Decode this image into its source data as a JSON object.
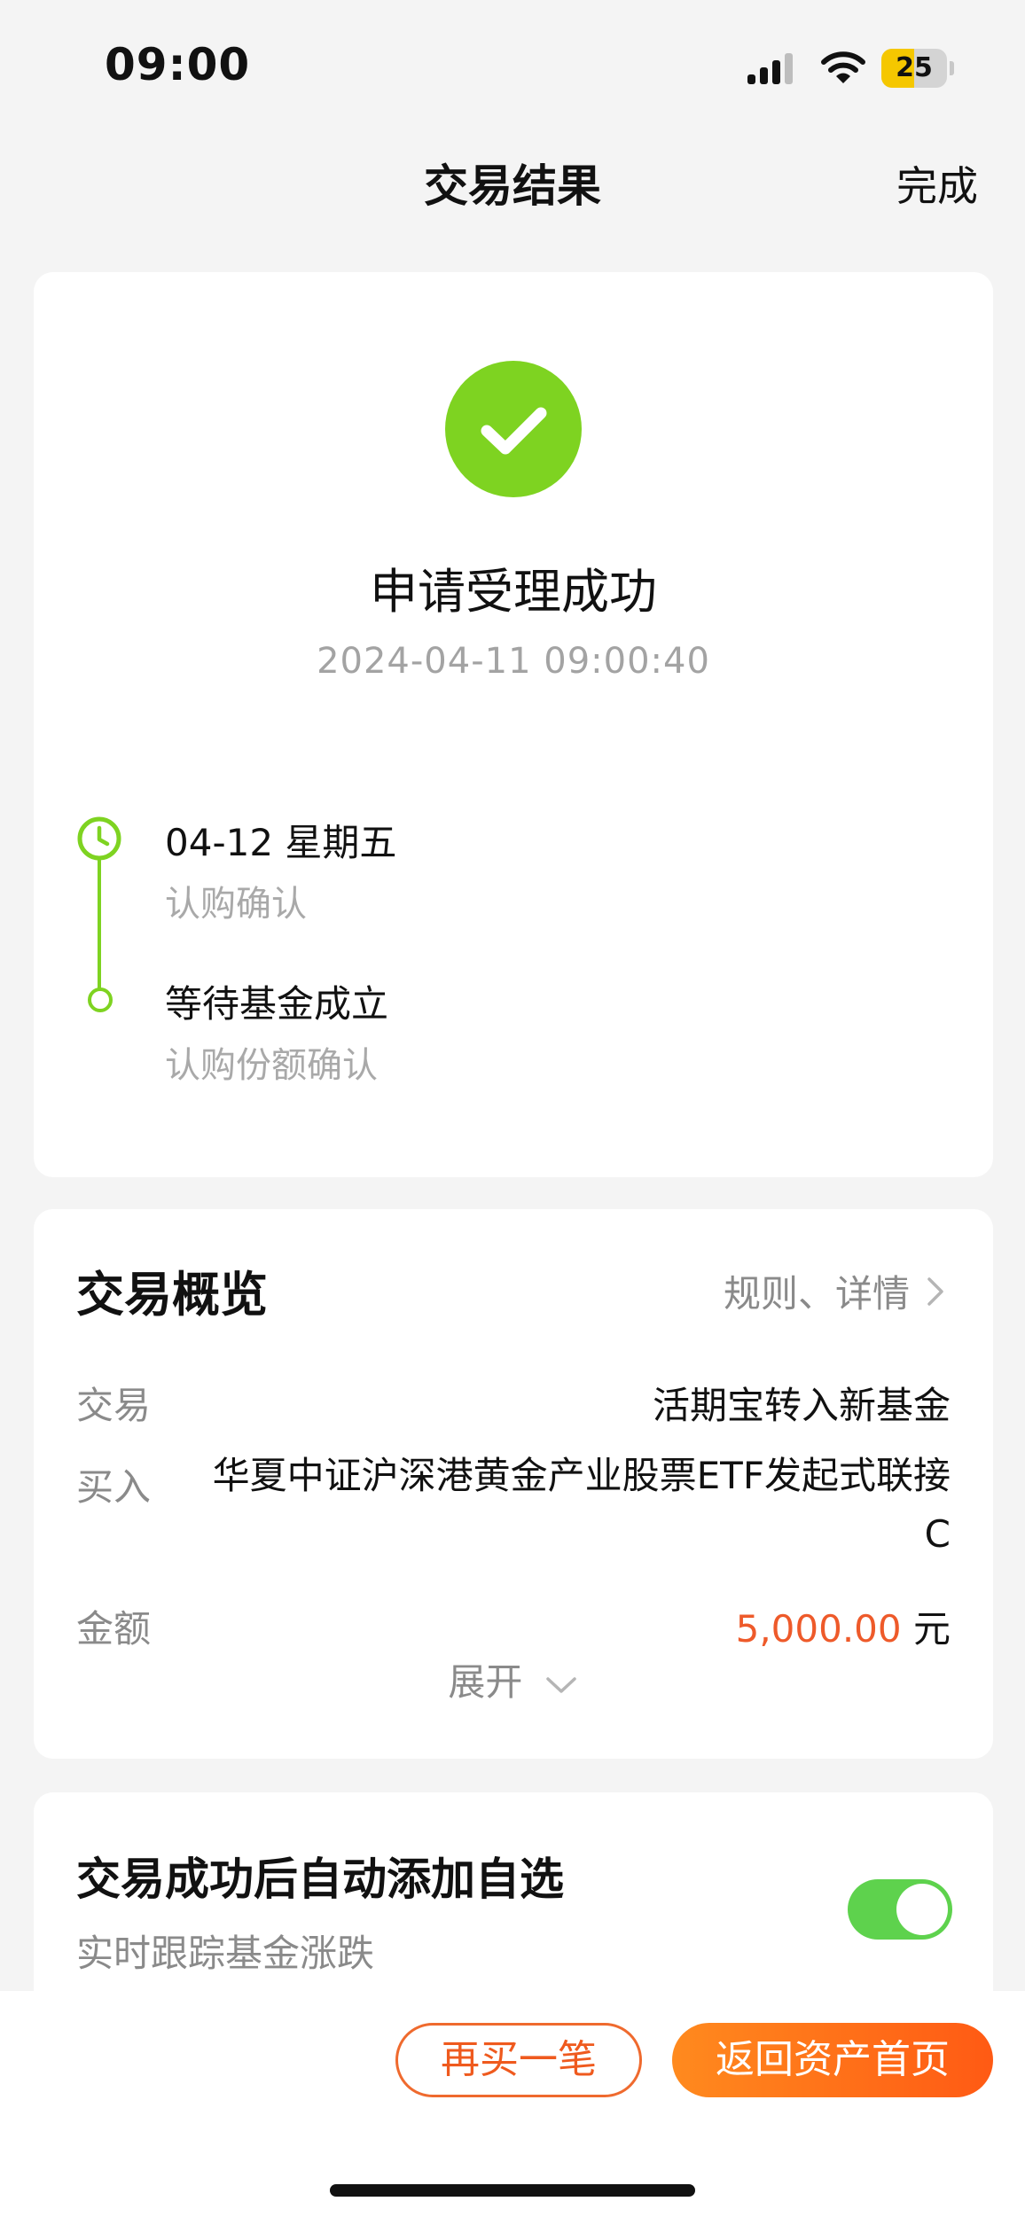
{
  "status_bar": {
    "time": "09:00",
    "battery_level": "25",
    "battery_fraction": 0.5,
    "icons": [
      "signal-icon",
      "wifi-icon",
      "battery-icon"
    ]
  },
  "nav": {
    "title": "交易结果",
    "done_label": "完成"
  },
  "result": {
    "icon": "checkmark-icon",
    "title": "申请受理成功",
    "timestamp": "2024-04-11 09:00:40",
    "timeline": [
      {
        "title": "04-12  星期五",
        "subtitle": "认购确认",
        "icon": "clock-icon"
      },
      {
        "title": "等待基金成立",
        "subtitle": "认购份额确认",
        "icon": "circle-icon"
      }
    ]
  },
  "overview": {
    "title": "交易概览",
    "link_label": "规则、详情",
    "rows": {
      "trade_label": "交易",
      "trade_value": "活期宝转入新基金",
      "buy_label": "买入",
      "buy_value": "华夏中证沪深港黄金产业股票ETF发起式联接C",
      "amount_label": "金额",
      "amount_value": "5,000.00",
      "amount_unit": "元"
    },
    "expand_label": "展开"
  },
  "auto_add": {
    "title": "交易成功后自动添加自选",
    "subtitle": "实时跟踪基金涨跌",
    "enabled": true
  },
  "actions": {
    "buy_again_label": "再买一笔",
    "back_home_label": "返回资产首页"
  },
  "colors": {
    "accent_orange": "#ff6a14",
    "success_green": "#7ed321",
    "amount_red": "#ee5a2a",
    "toggle_green": "#5ed24d"
  }
}
